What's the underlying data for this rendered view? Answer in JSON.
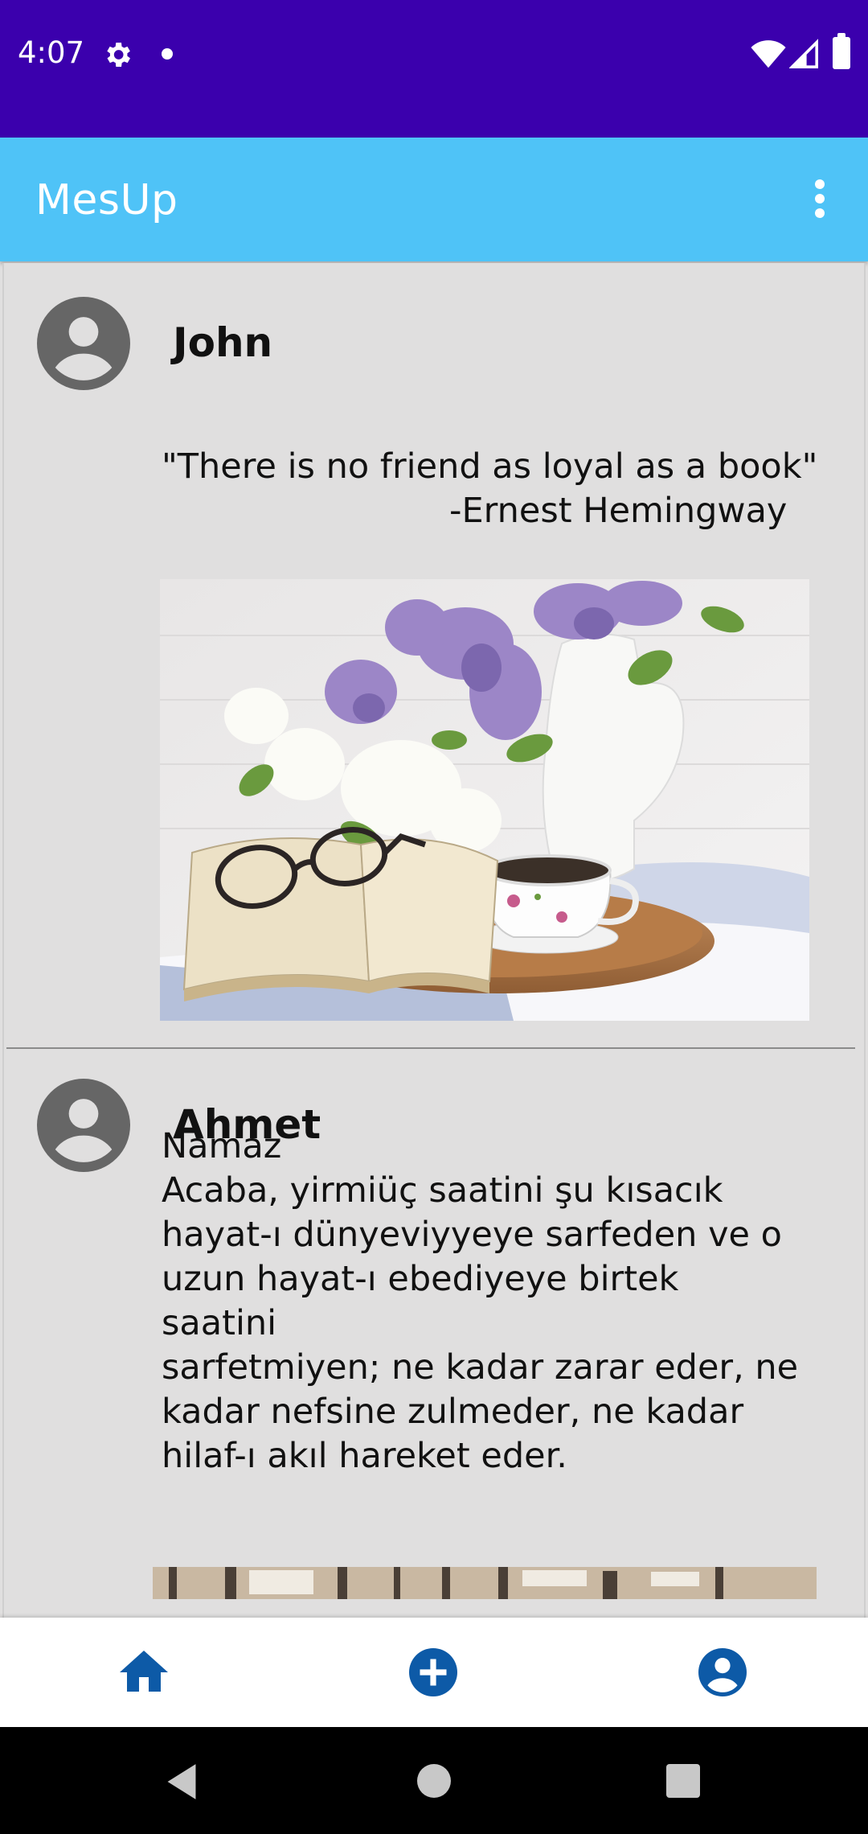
{
  "status_bar": {
    "time": "4:07",
    "icons": [
      "gear-icon",
      "notification-dot-icon",
      "wifi-icon",
      "cell-signal-icon",
      "battery-icon"
    ],
    "background": "#3b00ad"
  },
  "app_bar": {
    "title": "MesUp",
    "background": "#4fc3f7",
    "menu_icon": "more-vert-icon"
  },
  "posts": [
    {
      "user": "John",
      "avatar_icon": "account-circle-icon",
      "quote": "\"There is no friend as loyal as a book\"",
      "author": "-Ernest Hemingway",
      "image": "open book with glasses, teacup on wooden tray, lilac flowers in white pitcher"
    },
    {
      "user": "Ahmet",
      "avatar_icon": "account-circle-icon",
      "lines": [
        "Namaz",
        "Acaba, yirmiüç saatini şu kısacık",
        "hayat-ı dünyeviyyeye sarfeden ve o",
        "uzun hayat-ı ebediyeye birtek saatini",
        "sarfetmiyen; ne kadar zarar eder, ne",
        "kadar nefsine zulmeder, ne kadar",
        "hilaf-ı akıl hareket eder."
      ],
      "image": "building interior"
    }
  ],
  "bottom_nav": {
    "items": [
      {
        "icon": "home-icon",
        "active": true
      },
      {
        "icon": "add-circle-icon",
        "active": false
      },
      {
        "icon": "account-circle-icon",
        "active": false
      }
    ],
    "icon_color": "#0d5aa7"
  },
  "system_nav": {
    "icons": [
      "back-icon",
      "home-circle-icon",
      "recents-square-icon"
    ]
  }
}
